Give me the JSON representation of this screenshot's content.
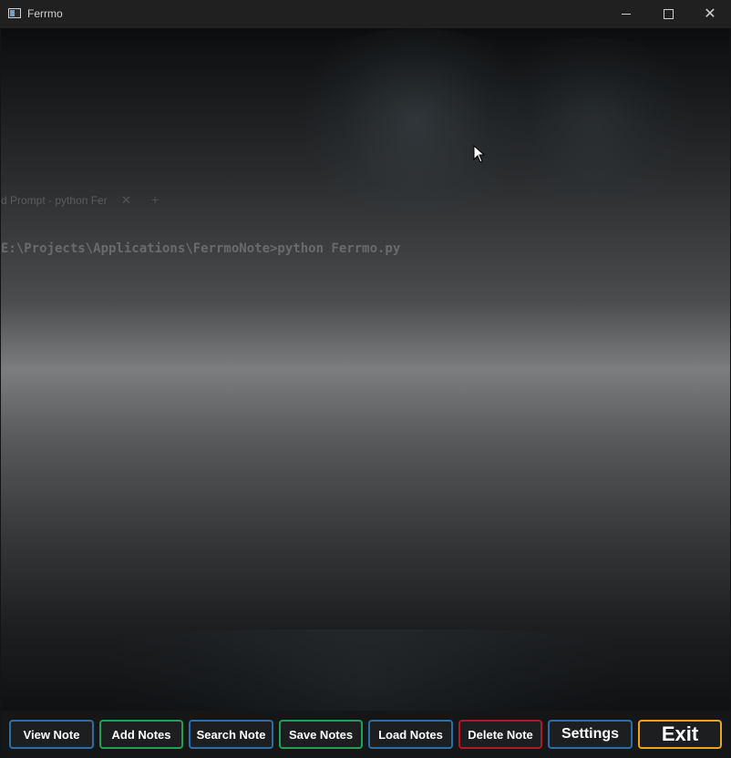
{
  "window": {
    "title": "Ferrmo",
    "controls": {
      "minimize_icon": "minimize-icon",
      "maximize_icon": "maximize-icon",
      "close_glyph": "✕"
    }
  },
  "background": {
    "ghost_tab_label": "d Prompt - python  Fer",
    "ghost_tab_close": "✕",
    "ghost_tab_add": "+",
    "ghost_command": "E:\\Projects\\Applications\\FerrmoNote>python Ferrmo.py"
  },
  "toolbar": {
    "view_note": "View Note",
    "add_notes": "Add Notes",
    "search_note": "Search Note",
    "save_notes": "Save Notes",
    "load_notes": "Load Notes",
    "delete_note": "Delete Note",
    "settings": "Settings",
    "exit": "Exit"
  },
  "colors": {
    "blue_border": "#2a6fa8",
    "green_border": "#1fa054",
    "red_border": "#b0182a",
    "orange_border": "#f2a417"
  }
}
